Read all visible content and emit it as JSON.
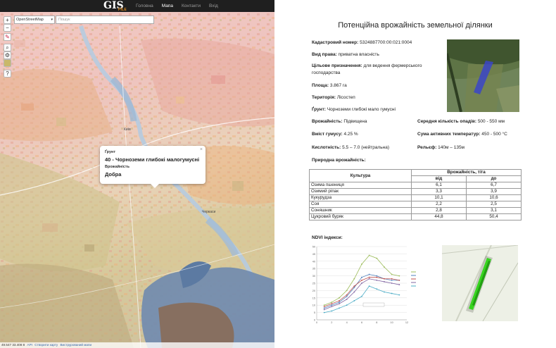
{
  "topbar": {
    "logo_main": "GIS",
    "logo_sub": "FILE",
    "nav": [
      "Головна",
      "Мапа",
      "Контакти",
      "Вхід"
    ],
    "active_nav": "Мапа"
  },
  "map_controls": {
    "zoom_in": "+",
    "zoom_out": "−",
    "layer_select": "OpenStreetMap",
    "search_placeholder": "Пошук",
    "help": "?"
  },
  "map_labels": {
    "kyiv": "Київ",
    "cherkasy": "Черкаси"
  },
  "popup": {
    "soil_label": "Ґрунт",
    "soil_value": "40 - Чорноземи глибокі малогумусні",
    "fertility_label": "Врожайність",
    "fertility_value": "Добра"
  },
  "statusbar": {
    "coords": "49.547 33.408 8",
    "links": [
      "API",
      "Створити карту",
      "Виструрований мапи"
    ]
  },
  "report": {
    "title": "Потенційна врожайність земельної ділянки",
    "cadastral_label": "Кадастровий номер:",
    "cadastral_value": "5324887700:00:021:0004",
    "right_label": "Вид права:",
    "right_value": "приватна власність",
    "purpose_label": "Цільове призначення:",
    "purpose_value": "для ведення фермерського господарства",
    "area_label": "Площа:",
    "area_value": "3.867 га",
    "territory_label": "Територія:",
    "territory_value": "Лісостеп",
    "soil_label": "Ґрунт:",
    "soil_value": "Чорноземи глибокі мало гумусні",
    "yield_label": "Врожайність:",
    "yield_value": "Підвищена",
    "precip_label": "Середня кількість опадів:",
    "precip_value": "500 - 550 мм",
    "humus_label": "Вміст гумусу:",
    "humus_value": "4.25 %",
    "temp_label": "Сума активних температур:",
    "temp_value": "450 - 500 °C",
    "acidity_label": "Кислотність:",
    "acidity_value": "5.5 – 7.0 (нейтральна)",
    "relief_label": "Рельєф:",
    "relief_value": "140м – 135м",
    "natural_yield_heading": "Природна врожайність:",
    "ndvi_heading": "NDVI індекси:"
  },
  "crop_table": {
    "col_crop": "Культура",
    "col_yield": "Врожайність, т/га",
    "col_from": "від",
    "col_to": "до",
    "rows": [
      {
        "crop": "Озима пшениця",
        "from": "6,1",
        "to": "6,7"
      },
      {
        "crop": "Озимий ріпак",
        "from": "3,3",
        "to": "3,9"
      },
      {
        "crop": "Кукурудза",
        "from": "10,1",
        "to": "10,6"
      },
      {
        "crop": "Соя",
        "from": "2,2",
        "to": "2,5"
      },
      {
        "crop": "Соняшник",
        "from": "2,8",
        "to": "3,1"
      },
      {
        "crop": "Цукровий буряк",
        "from": "44,8",
        "to": "50,4"
      }
    ]
  },
  "chart_data": {
    "type": "line",
    "title": "",
    "xlabel": "",
    "ylabel": "",
    "x": [
      1,
      2,
      3,
      4,
      5,
      6,
      7,
      8,
      9,
      10,
      11
    ],
    "xlim": [
      0,
      12
    ],
    "ylim": [
      0,
      50
    ],
    "y_ticks": [
      0,
      5,
      10,
      15,
      20,
      25,
      30,
      35,
      40,
      45,
      50
    ],
    "x_ticks": [
      0,
      2,
      4,
      6,
      8,
      10,
      12
    ],
    "grid": true,
    "legend_position": "right",
    "series": [
      {
        "color": "#9bbb59",
        "values": [
          10,
          12,
          15,
          20,
          28,
          38,
          44,
          42,
          36,
          31,
          30
        ]
      },
      {
        "color": "#4f81bd",
        "values": [
          8,
          10,
          12,
          16,
          22,
          29,
          31,
          30,
          28,
          27,
          27
        ]
      },
      {
        "color": "#c0504d",
        "values": [
          9,
          11,
          13,
          17,
          23,
          27,
          29,
          29,
          28,
          28,
          27
        ]
      },
      {
        "color": "#8064a2",
        "values": [
          7,
          9,
          11,
          14,
          19,
          25,
          28,
          27,
          26,
          25,
          24
        ]
      },
      {
        "color": "#4bacc6",
        "values": [
          5,
          6,
          8,
          10,
          13,
          16,
          23,
          21,
          19,
          18,
          17
        ]
      }
    ],
    "annotation": ""
  }
}
